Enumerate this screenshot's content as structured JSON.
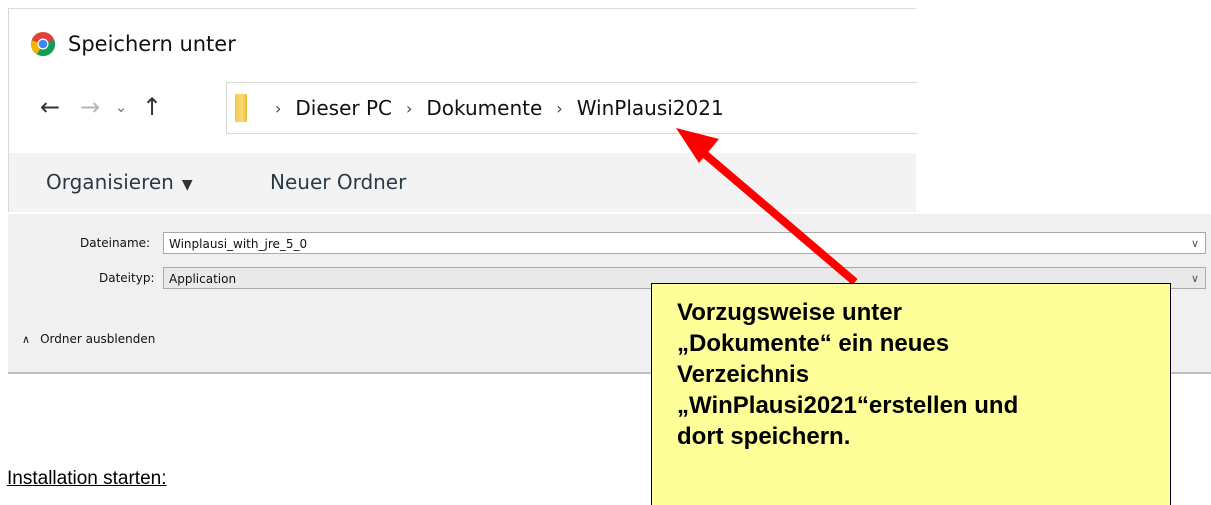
{
  "dialog": {
    "title": "Speichern unter",
    "nav": {
      "back_icon": "arrow-left-icon",
      "forward_icon": "arrow-right-icon",
      "recent_icon": "chevron-down-icon",
      "up_icon": "arrow-up-icon"
    },
    "breadcrumb": [
      "Dieser PC",
      "Dokumente",
      "WinPlausi2021"
    ],
    "toolbar": {
      "organize_label": "Organisieren",
      "new_folder_label": "Neuer Ordner"
    },
    "filename_label": "Dateiname:",
    "filename_value": "Winplausi_with_jre_5_0",
    "filetype_label": "Dateityp:",
    "filetype_value": "Application",
    "hide_folders_label": "Ordner ausblenden"
  },
  "annotation": {
    "text": "Vorzugsweise unter\n„Dokumente“ ein neues\nVerzeichnis\n„WinPlausi2021“erstellen und\ndort speichern.",
    "arrow_color": "#ff0000",
    "callout_color": "#ffff99"
  },
  "footer": {
    "link_text": "Installation starten:"
  }
}
